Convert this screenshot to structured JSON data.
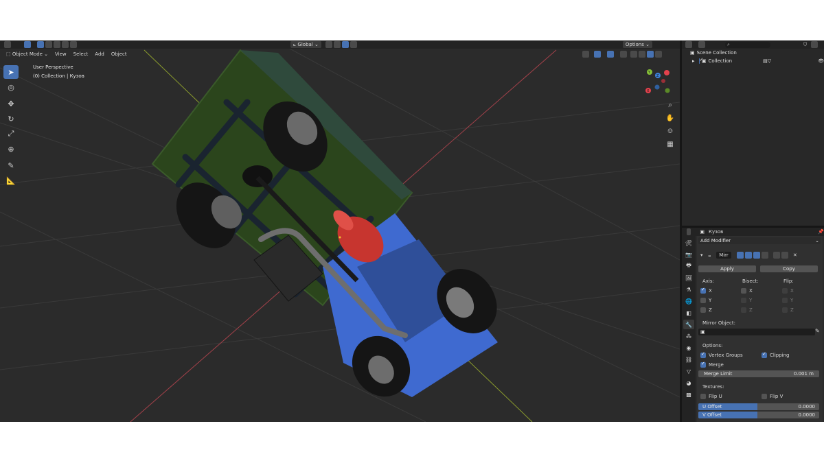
{
  "header": {
    "transform_orientation": "Global",
    "options_label": "Options"
  },
  "menu": {
    "mode": "Object Mode",
    "items": [
      "View",
      "Select",
      "Add",
      "Object"
    ]
  },
  "viewport": {
    "perspective_label": "User Perspective",
    "collection_label": "(0) Collection | Кузов",
    "gizmo": {
      "x_label": "X",
      "y_label": "Y",
      "z_label": "Z"
    },
    "colors": {
      "x": "#e4424d",
      "y": "#86c038",
      "z": "#3f83dc",
      "grid_x": "#a3414a",
      "grid_y": "#8a9b2d"
    }
  },
  "outliner": {
    "scene_collection": "Scene Collection",
    "collection": "Collection"
  },
  "properties": {
    "object_name": "Кузов",
    "add_modifier": "Add Modifier",
    "modifier_name": "Mirr",
    "apply": "Apply",
    "copy": "Copy",
    "axis_label": "Axis:",
    "bisect_label": "Bisect:",
    "flip_label": "Flip:",
    "axes": [
      "X",
      "Y",
      "Z"
    ],
    "mirror_object_label": "Mirror Object:",
    "options_label": "Options:",
    "vertex_groups": "Vertex Groups",
    "clipping": "Clipping",
    "merge": "Merge",
    "merge_limit_label": "Merge Limit",
    "merge_limit_value": "0.001 m",
    "textures_label": "Textures:",
    "flip_u": "Flip U",
    "flip_v": "Flip V",
    "u_offset_label": "U Offset",
    "u_offset_value": "0.0000",
    "v_offset_label": "V Offset",
    "v_offset_value": "0.0000"
  }
}
